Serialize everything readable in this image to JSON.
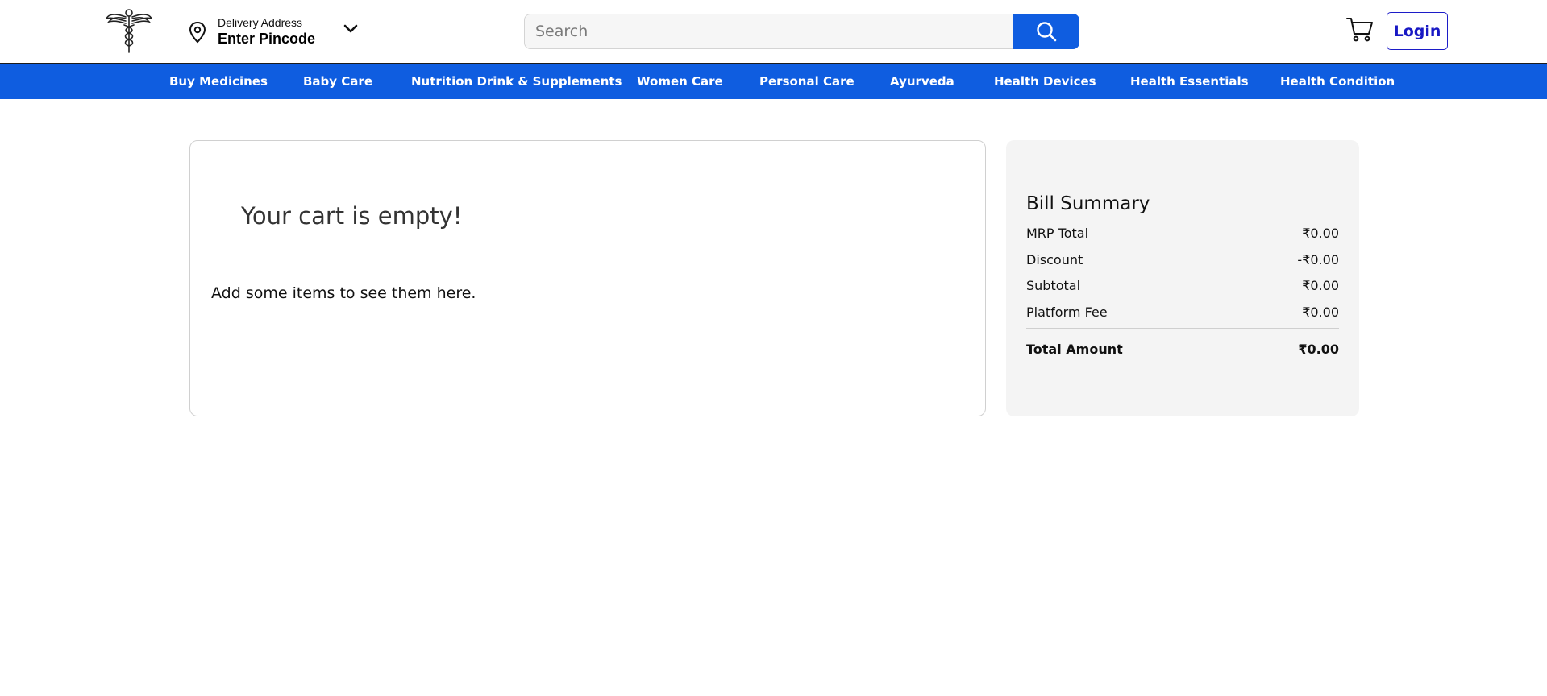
{
  "header": {
    "delivery_label": "Delivery Address",
    "delivery_value": "Enter Pincode",
    "search_placeholder": "Search",
    "login_label": "Login"
  },
  "nav": {
    "items": [
      "Buy Medicines",
      "Baby Care",
      "Nutrition Drink & Supplements",
      "Women Care",
      "Personal Care",
      "Ayurveda",
      "Health Devices",
      "Health Essentials",
      "Health Condition"
    ]
  },
  "cart": {
    "title": "Your cart is empty!",
    "subtitle": "Add some items to see them here."
  },
  "bill": {
    "title": "Bill Summary",
    "rows": [
      {
        "label": "MRP Total",
        "value": "₹0.00"
      },
      {
        "label": "Discount",
        "value": "-₹0.00"
      },
      {
        "label": "Subtotal",
        "value": "₹0.00"
      },
      {
        "label": "Platform Fee",
        "value": "₹0.00"
      }
    ],
    "total": {
      "label": "Total Amount",
      "value": "₹0.00"
    }
  },
  "icons": {
    "logo": "caduceus-logo-icon",
    "location": "location-pin-icon",
    "dropdown": "chevron-down-icon",
    "search": "search-icon",
    "cart": "cart-icon"
  },
  "colors": {
    "brand_blue": "#0f5de0",
    "login_blue": "#1818c4",
    "bill_bg": "#f4f4f4"
  }
}
